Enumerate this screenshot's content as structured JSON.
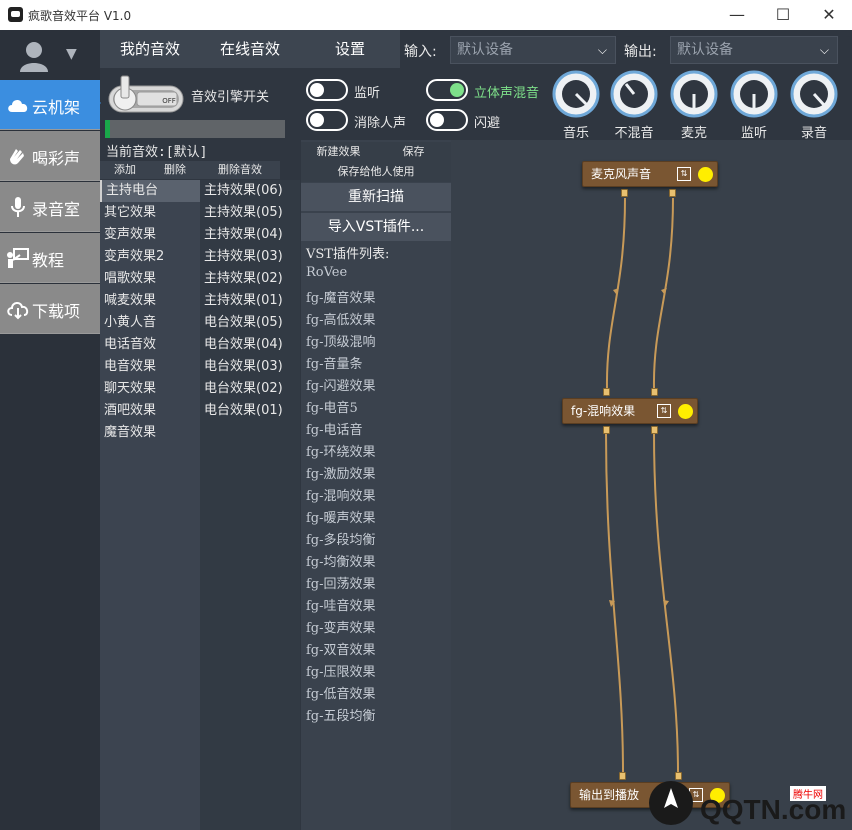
{
  "window": {
    "title": "疯歌音效平台 V1.0",
    "minimize": "—",
    "maximize": "☐",
    "close": "✕"
  },
  "sidebar": {
    "items": [
      {
        "label": "云机架",
        "icon": "cloud-icon"
      },
      {
        "label": "喝彩声",
        "icon": "clap-icon"
      },
      {
        "label": "录音室",
        "icon": "microphone-icon"
      },
      {
        "label": "教程",
        "icon": "teacher-icon"
      },
      {
        "label": "下载项",
        "icon": "cloud-download-icon"
      }
    ]
  },
  "tabs": [
    {
      "label": "我的音效"
    },
    {
      "label": "在线音效"
    },
    {
      "label": "设置"
    }
  ],
  "io": {
    "input_label": "输入:",
    "input_value": "默认设备",
    "output_label": "输出:",
    "output_value": "默认设备"
  },
  "engine": {
    "label": "音效引擎开关",
    "switch_text": "OFF",
    "level": 0.03
  },
  "toggles": [
    {
      "label": "监听",
      "on": false
    },
    {
      "label": "立体声混音",
      "on": true
    },
    {
      "label": "消除人声",
      "on": false
    },
    {
      "label": "闪避",
      "on": false
    }
  ],
  "knobs": [
    {
      "label": "音乐"
    },
    {
      "label": "不混音"
    },
    {
      "label": "麦克"
    },
    {
      "label": "监听"
    },
    {
      "label": "录音"
    }
  ],
  "current_effect": "当前音效:[默认]",
  "list_buttons": {
    "add": "添加",
    "delete": "删除",
    "delete_effect": "删除音效"
  },
  "categories": [
    "主持电台",
    "其它效果",
    "变声效果",
    "变声效果2",
    "唱歌效果",
    "喊麦效果",
    "小黄人音",
    "电话音效",
    "电音效果",
    "聊天效果",
    "酒吧效果",
    "魔音效果"
  ],
  "effects": [
    "主持效果(06)",
    "主持效果(05)",
    "主持效果(04)",
    "主持效果(03)",
    "主持效果(02)",
    "主持效果(01)",
    "电台效果(05)",
    "电台效果(04)",
    "电台效果(03)",
    "电台效果(02)",
    "电台效果(01)"
  ],
  "vst": {
    "new_effect": "新建效果",
    "save": "保存",
    "save_for_others": "保存给他人使用",
    "rescan": "重新扫描",
    "import": "导入VST插件...",
    "list_title": "VST插件列表:",
    "plugins": [
      "RoVee",
      "fg-魔音效果",
      "fg-高低效果",
      "fg-顶级混响",
      "fg-音量条",
      "fg-闪避效果",
      "fg-电音5",
      "fg-电话音",
      "fg-环绕效果",
      "fg-激励效果",
      "fg-混响效果",
      "fg-暖声效果",
      "fg-多段均衡",
      "fg-均衡效果",
      "fg-回荡效果",
      "fg-哇音效果",
      "fg-变声效果",
      "fg-双音效果",
      "fg-压限效果",
      "fg-低音效果",
      "fg-五段均衡"
    ]
  },
  "graph": {
    "nodes": [
      {
        "label": "麦克风声音"
      },
      {
        "label": "fg-混响效果"
      },
      {
        "label": "输出到播放"
      }
    ]
  },
  "watermark": {
    "text": "QQTN.com",
    "badge": "腾牛网"
  }
}
